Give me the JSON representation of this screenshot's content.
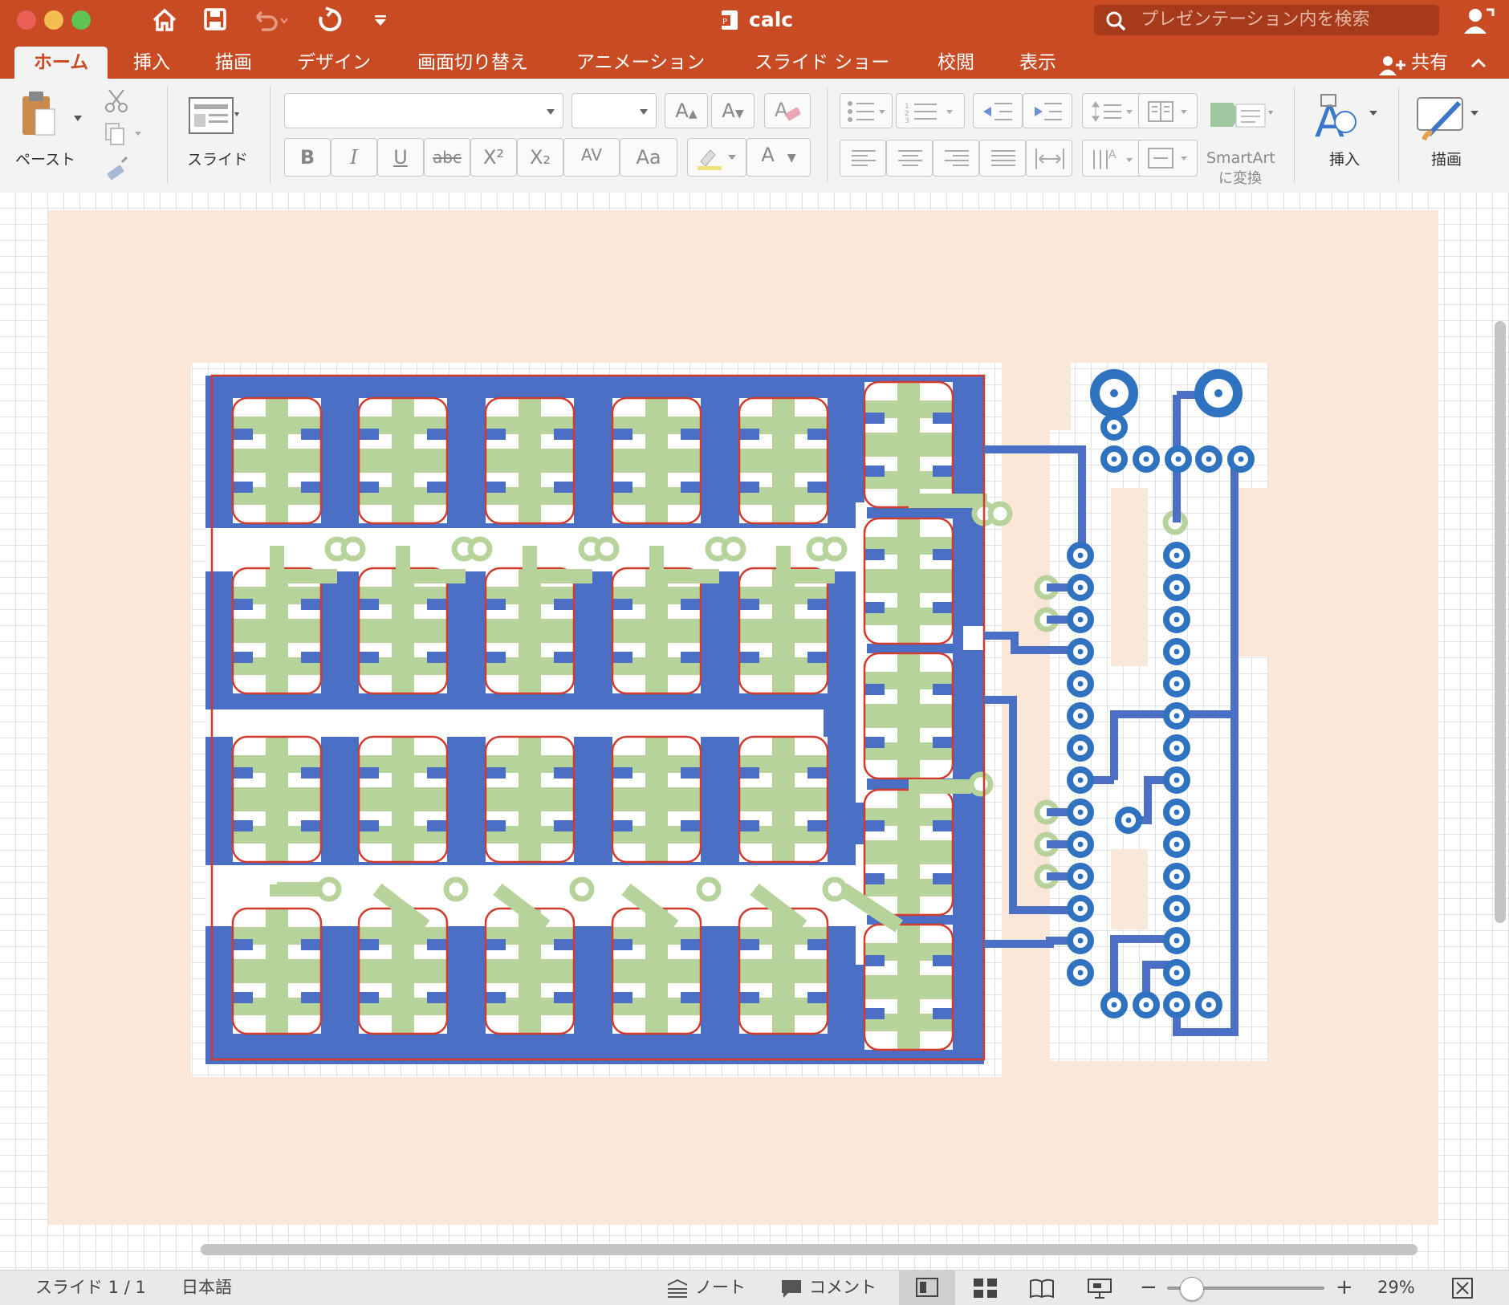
{
  "app": {
    "title": "calc",
    "search_placeholder": "プレゼンテーション内を検索",
    "accent": "#c84b24"
  },
  "tabs": [
    {
      "label": "ホーム",
      "active": true
    },
    {
      "label": "挿入"
    },
    {
      "label": "描画"
    },
    {
      "label": "デザイン"
    },
    {
      "label": "画面切り替え"
    },
    {
      "label": "アニメーション"
    },
    {
      "label": "スライド ショー"
    },
    {
      "label": "校閲"
    },
    {
      "label": "表示"
    }
  ],
  "share_label": "共有",
  "ribbon": {
    "paste": "ペースト",
    "slide": "スライド",
    "bold": "B",
    "italic": "I",
    "underline": "U",
    "strike": "abc",
    "superscript": "X²",
    "subscript": "X₂",
    "spacing": "AV",
    "change_case": "Aa",
    "font_color": "A",
    "grow": "A",
    "shrink": "A",
    "smartart_1": "SmartArt",
    "smartart_2": "に変換",
    "insert": "挿入",
    "draw": "描画"
  },
  "status": {
    "slide": "スライド 1 / 1",
    "language": "日本語",
    "notes": "ノート",
    "comments": "コメント",
    "zoom": "29%",
    "zoom_level": 0.29
  },
  "colors": {
    "trace_blue": "#4a6fc4",
    "pad_green": "#b6d39b",
    "via_blue": "#2f72c0",
    "outline_red": "#d23a2b",
    "slide_bg": "#fbe7d8"
  }
}
